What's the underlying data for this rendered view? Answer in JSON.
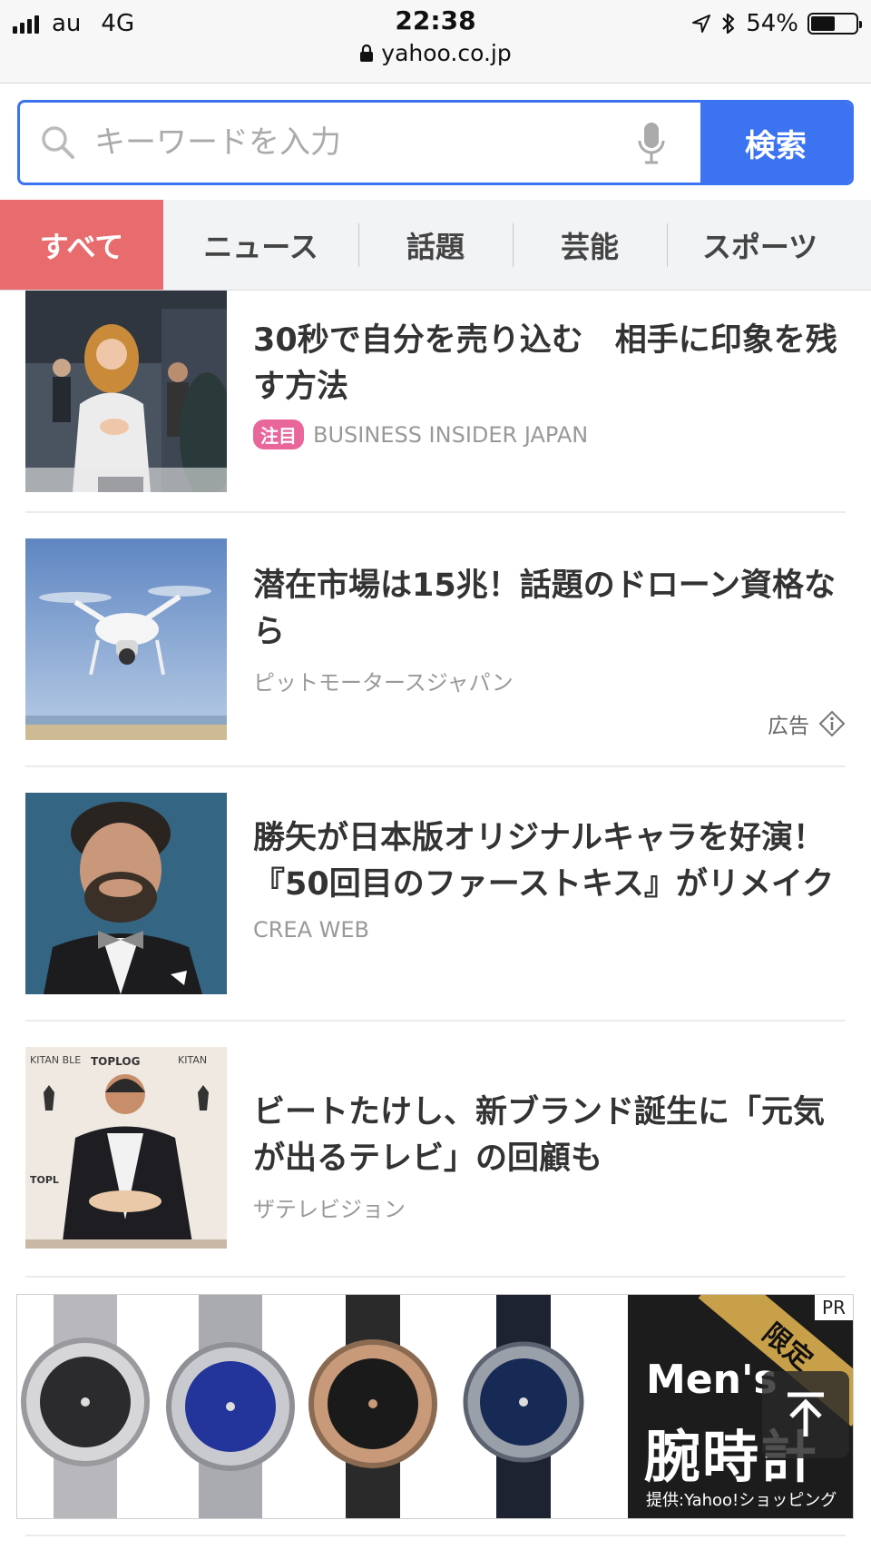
{
  "status_bar": {
    "carrier": "au",
    "network": "4G",
    "time": "22:38",
    "battery": "54%",
    "battery_level": 0.54,
    "url": "yahoo.co.jp"
  },
  "search": {
    "placeholder": "キーワードを入力",
    "button_label": "検索"
  },
  "tabs": [
    {
      "label": "すべて",
      "active": true
    },
    {
      "label": "ニュース"
    },
    {
      "label": "話題"
    },
    {
      "label": "芸能"
    },
    {
      "label": "スポーツ"
    }
  ],
  "articles": [
    {
      "title": "30秒で自分を売り込む　相手に印象を残す方法",
      "badge": "注目",
      "source": "BUSINESS INSIDER JAPAN"
    },
    {
      "title": "潜在市場は15兆！話題のドローン資格なら",
      "source": "ピットモータースジャパン",
      "ad_label": "広告"
    },
    {
      "title": "勝矢が日本版オリジナルキャラを好演！『50回目のファーストキス』がリメイク",
      "source": "CREA WEB"
    },
    {
      "title": "ビートたけし、新ブランド誕生に「元気が出るテレビ」の回顧も",
      "source": "ザテレビジョン"
    }
  ],
  "banner": {
    "pr_label": "PR",
    "ribbon_text": "限定",
    "headline_en": "Men's",
    "headline_jp": "腕時計",
    "provider": "提供:Yahoo!ショッピング"
  },
  "colors": {
    "accent_blue": "#3b73f0",
    "active_tab": "#e86c6e",
    "badge_pink": "#e8669a"
  }
}
